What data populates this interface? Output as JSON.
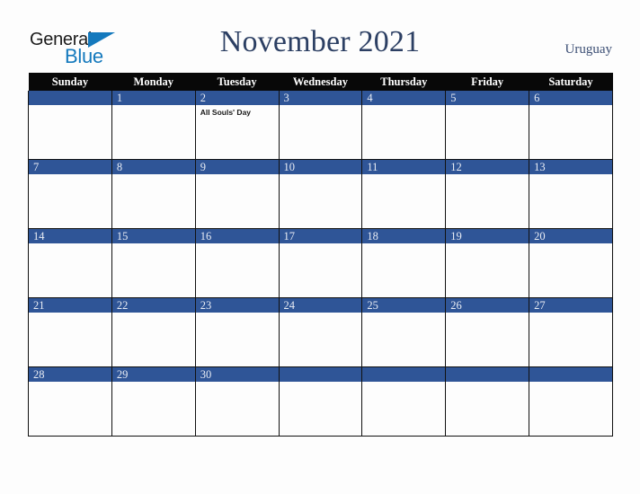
{
  "logo": {
    "word1": "General",
    "word2": "Blue",
    "triangle_color": "#1479bd",
    "icon": "blue-triangle-icon"
  },
  "header": {
    "title": "November 2021",
    "country": "Uruguay",
    "title_color": "#2c3f63"
  },
  "calendar": {
    "weekday_headers": [
      "Sunday",
      "Monday",
      "Tuesday",
      "Wednesday",
      "Thursday",
      "Friday",
      "Saturday"
    ],
    "header_bg": "#080808",
    "daynum_bg": "#2f5597",
    "daynum_color": "#e8ecf4",
    "weeks": [
      [
        {
          "day": "",
          "events": []
        },
        {
          "day": "1",
          "events": []
        },
        {
          "day": "2",
          "events": [
            "All Souls' Day"
          ]
        },
        {
          "day": "3",
          "events": []
        },
        {
          "day": "4",
          "events": []
        },
        {
          "day": "5",
          "events": []
        },
        {
          "day": "6",
          "events": []
        }
      ],
      [
        {
          "day": "7",
          "events": []
        },
        {
          "day": "8",
          "events": []
        },
        {
          "day": "9",
          "events": []
        },
        {
          "day": "10",
          "events": []
        },
        {
          "day": "11",
          "events": []
        },
        {
          "day": "12",
          "events": []
        },
        {
          "day": "13",
          "events": []
        }
      ],
      [
        {
          "day": "14",
          "events": []
        },
        {
          "day": "15",
          "events": []
        },
        {
          "day": "16",
          "events": []
        },
        {
          "day": "17",
          "events": []
        },
        {
          "day": "18",
          "events": []
        },
        {
          "day": "19",
          "events": []
        },
        {
          "day": "20",
          "events": []
        }
      ],
      [
        {
          "day": "21",
          "events": []
        },
        {
          "day": "22",
          "events": []
        },
        {
          "day": "23",
          "events": []
        },
        {
          "day": "24",
          "events": []
        },
        {
          "day": "25",
          "events": []
        },
        {
          "day": "26",
          "events": []
        },
        {
          "day": "27",
          "events": []
        }
      ],
      [
        {
          "day": "28",
          "events": []
        },
        {
          "day": "29",
          "events": []
        },
        {
          "day": "30",
          "events": []
        },
        {
          "day": "",
          "events": []
        },
        {
          "day": "",
          "events": []
        },
        {
          "day": "",
          "events": []
        },
        {
          "day": "",
          "events": []
        }
      ]
    ]
  }
}
